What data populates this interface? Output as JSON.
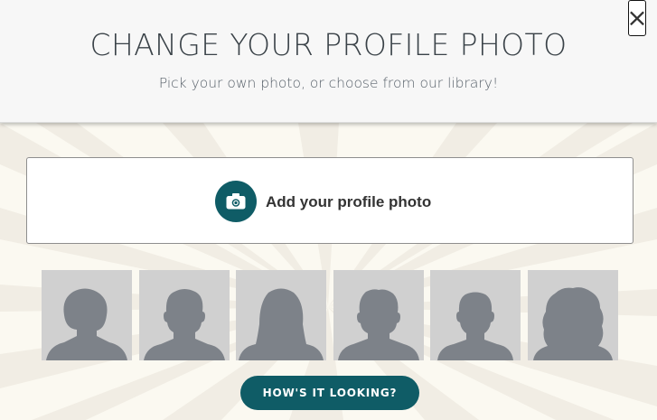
{
  "header": {
    "title": "CHANGE YOUR PROFILE PHOTO",
    "subtitle": "Pick your own photo, or choose from our library!",
    "close_symbol": "×"
  },
  "upload": {
    "label": "Add your profile photo",
    "icon": "camera-icon"
  },
  "library": {
    "avatars": [
      {
        "icon": "female-avatar-icon"
      },
      {
        "icon": "male-avatar-icon"
      },
      {
        "icon": "female-long-hair-avatar-icon"
      },
      {
        "icon": "male-avatar-icon"
      },
      {
        "icon": "male-avatar-icon"
      },
      {
        "icon": "female-curly-hair-avatar-icon"
      }
    ]
  },
  "actions": {
    "submit_label": "HOW'S IT LOOKING?"
  },
  "colors": {
    "accent": "#0f5c66",
    "avatar_bg": "#d0d0d0",
    "silhouette": "#7d8289",
    "header_bg": "#f7f7f7",
    "page_bg": "#fbf9f1"
  }
}
